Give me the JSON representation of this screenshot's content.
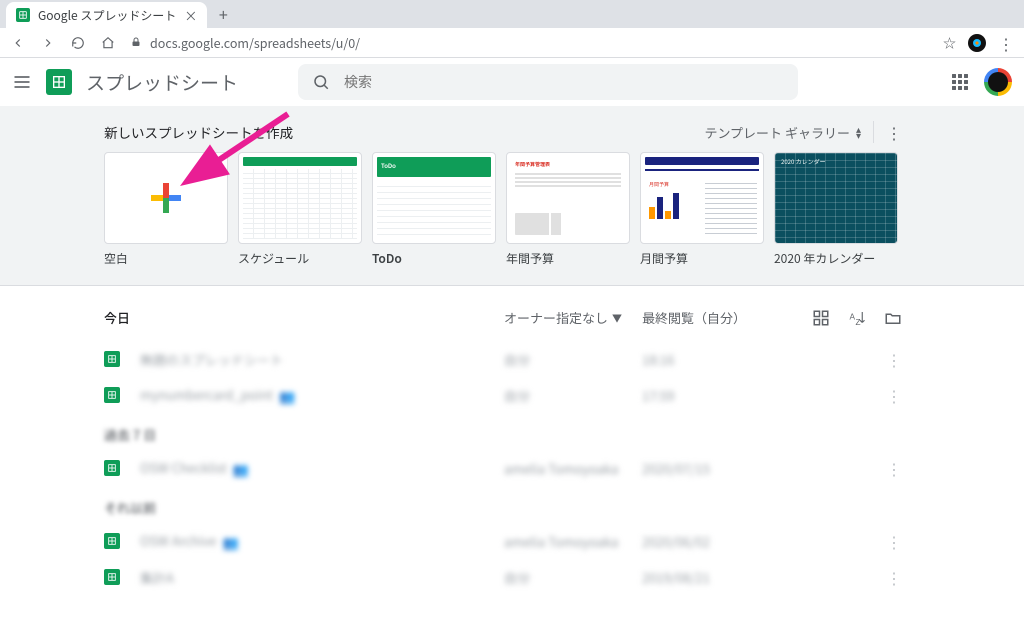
{
  "browser": {
    "tab_title": "Google スプレッドシート",
    "url": "docs.google.com/spreadsheets/u/0/"
  },
  "header": {
    "app_title": "スプレッドシート",
    "search_placeholder": "検索"
  },
  "templates": {
    "section_title": "新しいスプレッドシートを作成",
    "gallery_label": "テンプレート ギャラリー",
    "cards": [
      {
        "caption": "空白"
      },
      {
        "caption": "スケジュール"
      },
      {
        "caption": "ToDo"
      },
      {
        "caption": "年間予算"
      },
      {
        "caption": "月間予算"
      },
      {
        "caption": "2020 年カレンダー"
      }
    ]
  },
  "list": {
    "section_today": "今日",
    "owner_filter": "オーナー指定なし",
    "opened_header": "最終閲覧（自分）",
    "sections": {
      "past_days": "過去 7 日",
      "earlier": "それ以前"
    },
    "rows": [
      {
        "name": "無題のスプレッドシート",
        "owner": "自分",
        "date": "18:16",
        "shared": false
      },
      {
        "name": "mynumbercard_point",
        "owner": "自分",
        "date": "17:59",
        "shared": true
      },
      {
        "name": "OSW Checklist",
        "owner": "amelia Tomoyoaka",
        "date": "2020/07/15",
        "shared": true
      },
      {
        "name": "OSW Archive",
        "owner": "amelia Tomoyoaka",
        "date": "2020/06/02",
        "shared": true
      },
      {
        "name": "集計A",
        "owner": "自分",
        "date": "2019/08/21",
        "shared": false
      }
    ]
  }
}
